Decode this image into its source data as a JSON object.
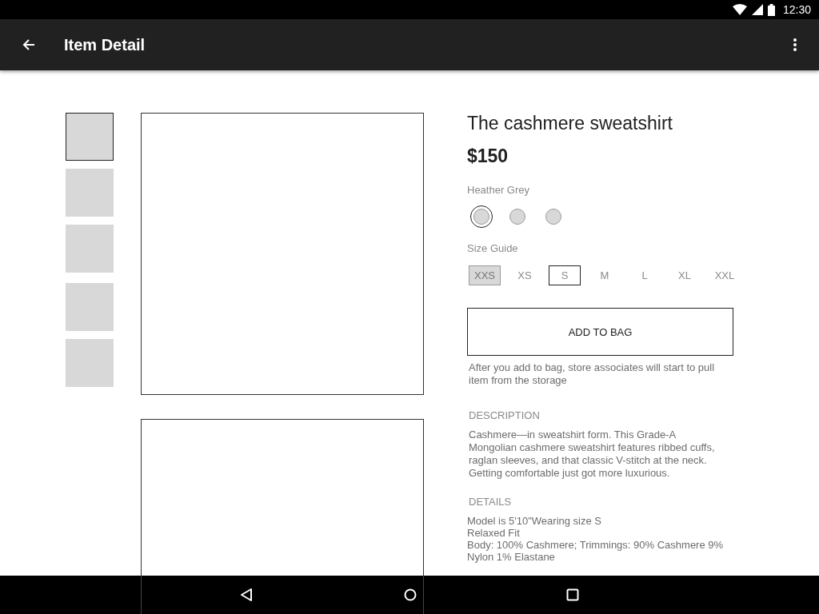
{
  "status_bar": {
    "time": "12:30"
  },
  "toolbar": {
    "title": "Item Detail"
  },
  "thumbnails": [
    {
      "selected": true
    },
    {
      "selected": false
    },
    {
      "selected": false
    },
    {
      "selected": false
    },
    {
      "selected": false
    }
  ],
  "product": {
    "title": "The cashmere sweatshirt",
    "price": "$150",
    "color_label": "Heather Grey",
    "swatches": [
      {
        "selected": true
      },
      {
        "selected": false
      },
      {
        "selected": false
      }
    ],
    "size_label": "Size Guide",
    "sizes": [
      {
        "label": "XXS",
        "selected": false,
        "disabled": true
      },
      {
        "label": "XS",
        "selected": false,
        "disabled": false
      },
      {
        "label": "S",
        "selected": true,
        "disabled": false
      },
      {
        "label": "M",
        "selected": false,
        "disabled": false
      },
      {
        "label": "L",
        "selected": false,
        "disabled": false
      },
      {
        "label": "XL",
        "selected": false,
        "disabled": false
      },
      {
        "label": "XXL",
        "selected": false,
        "disabled": false
      }
    ],
    "add_button": "ADD TO BAG",
    "note": "After you add to bag, store associates will start to pull item from the storage",
    "description_heading": "DESCRIPTION",
    "description": "Cashmere—in sweatshirt form. This Grade-A Mongolian cashmere sweatshirt features ribbed cuffs, raglan sleeves, and that classic V-stitch at the neck. Getting comfortable just got more luxurious.",
    "details_heading": "DETAILS",
    "details": [
      "Model is 5'10\"Wearing size S",
      "Relaxed Fit",
      "Body: 100% Cashmere; Trimmings: 90% Cashmere 9% Nylon 1% Elastane"
    ]
  }
}
